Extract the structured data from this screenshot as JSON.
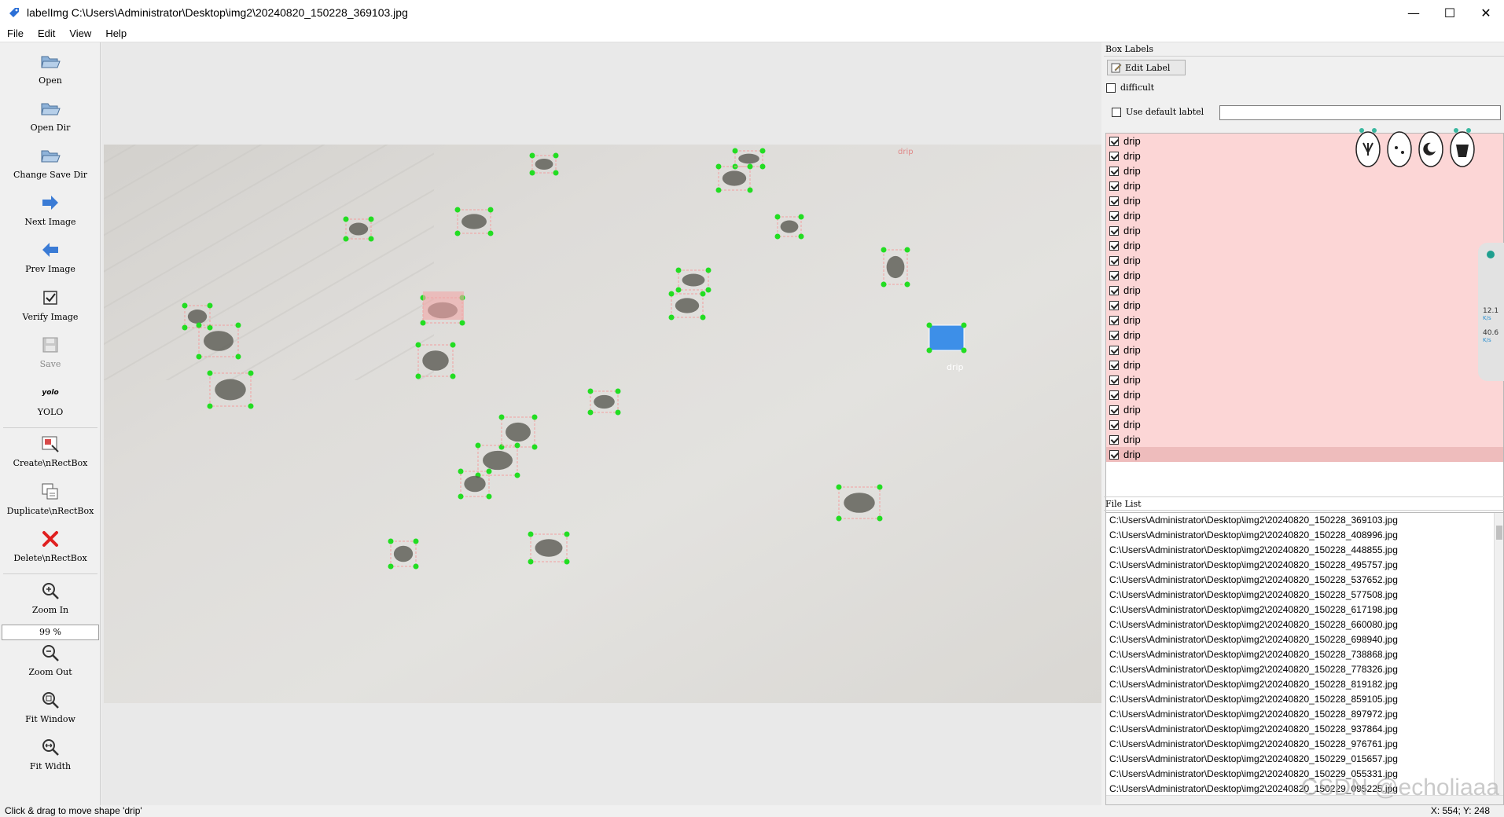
{
  "window": {
    "title": "labelImg C:\\Users\\Administrator\\Desktop\\img2\\20240820_150228_369103.jpg",
    "minimize": "—",
    "maximize": "☐",
    "close": "✕"
  },
  "menu": [
    "File",
    "Edit",
    "View",
    "Help"
  ],
  "toolbar": {
    "open": "Open",
    "open_dir": "Open Dir",
    "change_save_dir": "Change Save Dir",
    "next_image": "Next Image",
    "prev_image": "Prev Image",
    "verify_image": "Verify Image",
    "save": "Save",
    "format_icon_text": "yolo",
    "format": "YOLO",
    "create_rect": "Create\\nRectBox",
    "duplicate_rect": "Duplicate\\nRectBox",
    "delete_rect": "Delete\\nRectBox",
    "zoom_in": "Zoom In",
    "zoom_value": "99 %",
    "zoom_out": "Zoom Out",
    "fit_window": "Fit Window",
    "fit_width": "Fit Width"
  },
  "box_labels": {
    "title": "Box Labels",
    "edit_label": "Edit Label",
    "difficult": "difficult",
    "use_default_label": "Use default labtel",
    "default_label_value": "",
    "items": [
      "drip",
      "drip",
      "drip",
      "drip",
      "drip",
      "drip",
      "drip",
      "drip",
      "drip",
      "drip",
      "drip",
      "drip",
      "drip",
      "drip",
      "drip",
      "drip",
      "drip",
      "drip",
      "drip",
      "drip",
      "drip",
      "drip"
    ]
  },
  "file_list": {
    "title": "File List",
    "files": [
      "C:\\Users\\Administrator\\Desktop\\img2\\20240820_150228_369103.jpg",
      "C:\\Users\\Administrator\\Desktop\\img2\\20240820_150228_408996.jpg",
      "C:\\Users\\Administrator\\Desktop\\img2\\20240820_150228_448855.jpg",
      "C:\\Users\\Administrator\\Desktop\\img2\\20240820_150228_495757.jpg",
      "C:\\Users\\Administrator\\Desktop\\img2\\20240820_150228_537652.jpg",
      "C:\\Users\\Administrator\\Desktop\\img2\\20240820_150228_577508.jpg",
      "C:\\Users\\Administrator\\Desktop\\img2\\20240820_150228_617198.jpg",
      "C:\\Users\\Administrator\\Desktop\\img2\\20240820_150228_660080.jpg",
      "C:\\Users\\Administrator\\Desktop\\img2\\20240820_150228_698940.jpg",
      "C:\\Users\\Administrator\\Desktop\\img2\\20240820_150228_738868.jpg",
      "C:\\Users\\Administrator\\Desktop\\img2\\20240820_150228_778326.jpg",
      "C:\\Users\\Administrator\\Desktop\\img2\\20240820_150228_819182.jpg",
      "C:\\Users\\Administrator\\Desktop\\img2\\20240820_150228_859105.jpg",
      "C:\\Users\\Administrator\\Desktop\\img2\\20240820_150228_897972.jpg",
      "C:\\Users\\Administrator\\Desktop\\img2\\20240820_150228_937864.jpg",
      "C:\\Users\\Administrator\\Desktop\\img2\\20240820_150228_976761.jpg",
      "C:\\Users\\Administrator\\Desktop\\img2\\20240820_150229_015657.jpg",
      "C:\\Users\\Administrator\\Desktop\\img2\\20240820_150229_055331.jpg",
      "C:\\Users\\Administrator\\Desktop\\img2\\20240820_150229_095225.jpg"
    ]
  },
  "canvas": {
    "selected_label": "drip",
    "faded_label": "drip"
  },
  "side_widget": {
    "upload": "12.1",
    "download": "40.6",
    "unit": "K/s"
  },
  "status": {
    "message": "Click & drag to move shape 'drip'",
    "coords": "X: 554; Y: 248"
  },
  "watermark": "CSDN @echoliaaa",
  "colors": {
    "label_row_bg": "#fcd6d6",
    "label_row_selected": "#eebcbc",
    "handle": "#22dd22",
    "selected_fill": "#3d8fe8"
  }
}
